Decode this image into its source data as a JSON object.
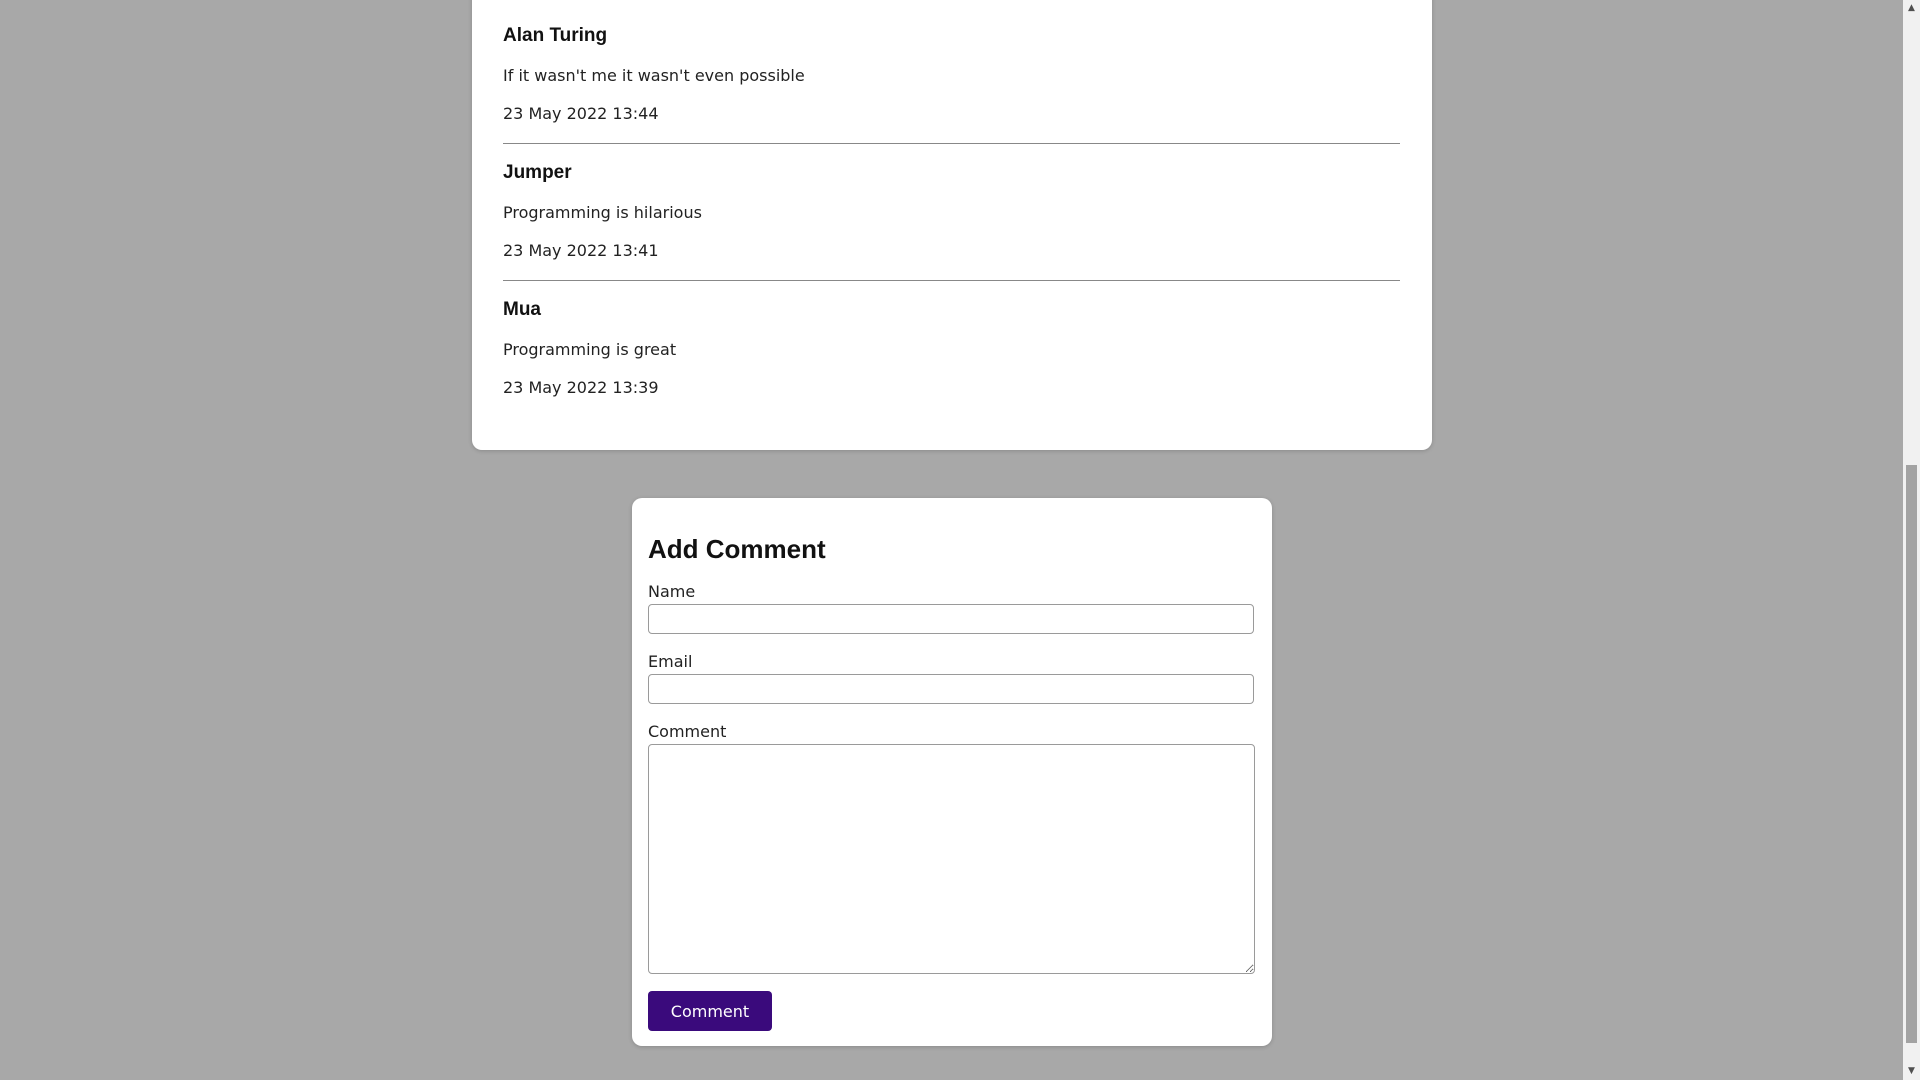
{
  "comments": [
    {
      "author": "Alan Turing",
      "body": "If it wasn't me it wasn't even possible",
      "date": "23 May 2022 13:44"
    },
    {
      "author": "Jumper",
      "body": "Programming is hilarious",
      "date": "23 May 2022 13:41"
    },
    {
      "author": "Mua",
      "body": "Programming is great",
      "date": "23 May 2022 13:39"
    }
  ],
  "form": {
    "title": "Add Comment",
    "name_label": "Name",
    "name_value": "",
    "email_label": "Email",
    "email_value": "",
    "comment_label": "Comment",
    "comment_value": "",
    "submit_label": "Comment"
  },
  "icons": {
    "scroll_up": "triangle-up-icon",
    "scroll_down": "triangle-down-icon"
  },
  "colors": {
    "page_background": "#a8a8a8",
    "card_background": "#ffffff",
    "button_background": "#3a0a7c",
    "button_text": "#ffffff"
  }
}
